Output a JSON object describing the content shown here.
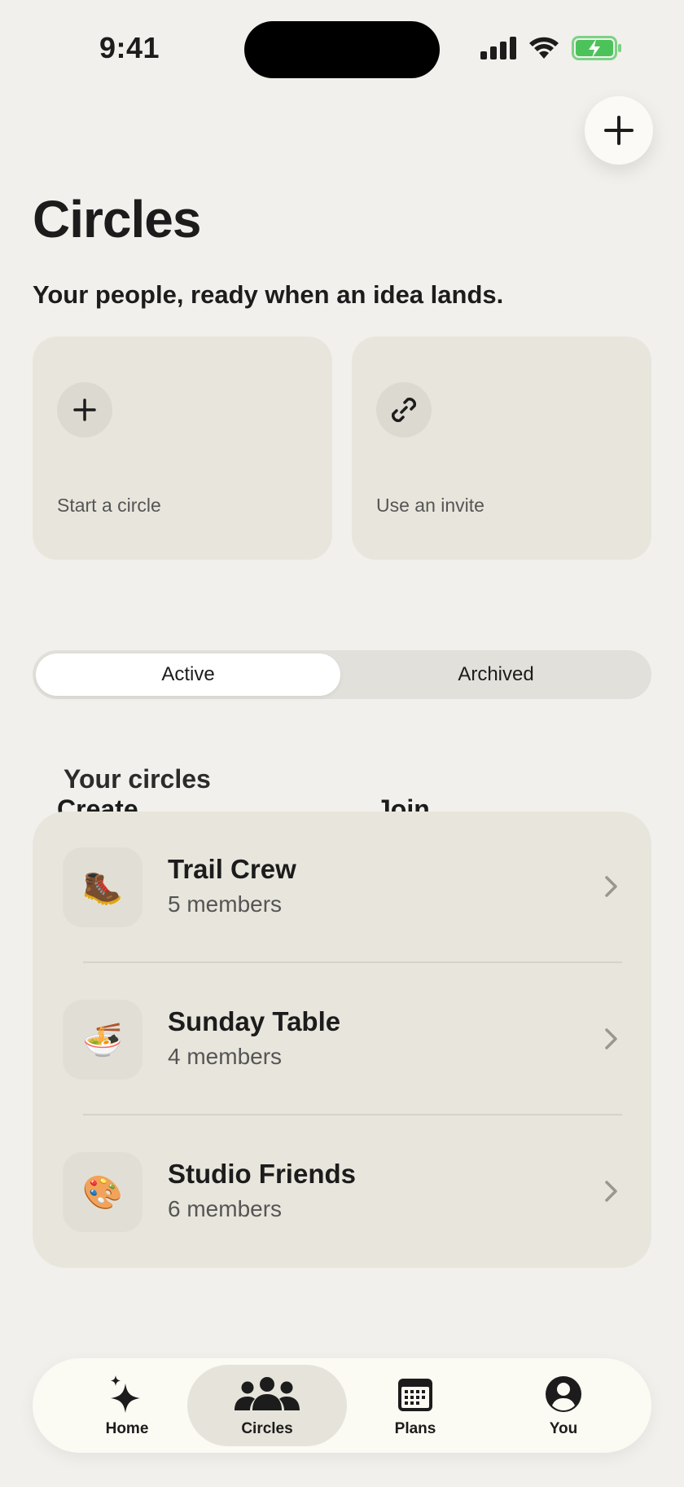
{
  "status_bar": {
    "time": "9:41",
    "icons": [
      "cellular-signal-icon",
      "wifi-icon",
      "battery-charging-icon"
    ]
  },
  "header": {
    "add_icon": "plus-icon",
    "title": "Circles",
    "subtitle": "Your people, ready when an idea lands."
  },
  "actions": [
    {
      "icon": "plus-icon",
      "title": "Create",
      "subtitle": "Start a circle"
    },
    {
      "icon": "link-icon",
      "title": "Join",
      "subtitle": "Use an invite"
    }
  ],
  "segmented": {
    "options": [
      "Active",
      "Archived"
    ],
    "selected": "Active"
  },
  "section": {
    "title": "Your circles"
  },
  "circles": [
    {
      "emoji": "🥾",
      "name": "Trail Crew",
      "members": "5 members"
    },
    {
      "emoji": "🍜",
      "name": "Sunday Table",
      "members": "4 members"
    },
    {
      "emoji": "🎨",
      "name": "Studio Friends",
      "members": "6 members"
    }
  ],
  "tabbar": {
    "items": [
      {
        "label": "Home",
        "icon": "sparkle-icon"
      },
      {
        "label": "Circles",
        "icon": "people-icon"
      },
      {
        "label": "Plans",
        "icon": "calendar-icon"
      },
      {
        "label": "You",
        "icon": "person-circle-icon"
      }
    ],
    "selected": "Circles"
  },
  "colors": {
    "background": "#f1f0ec",
    "card": "#e8e6dc",
    "battery_green": "#4cc35a"
  }
}
